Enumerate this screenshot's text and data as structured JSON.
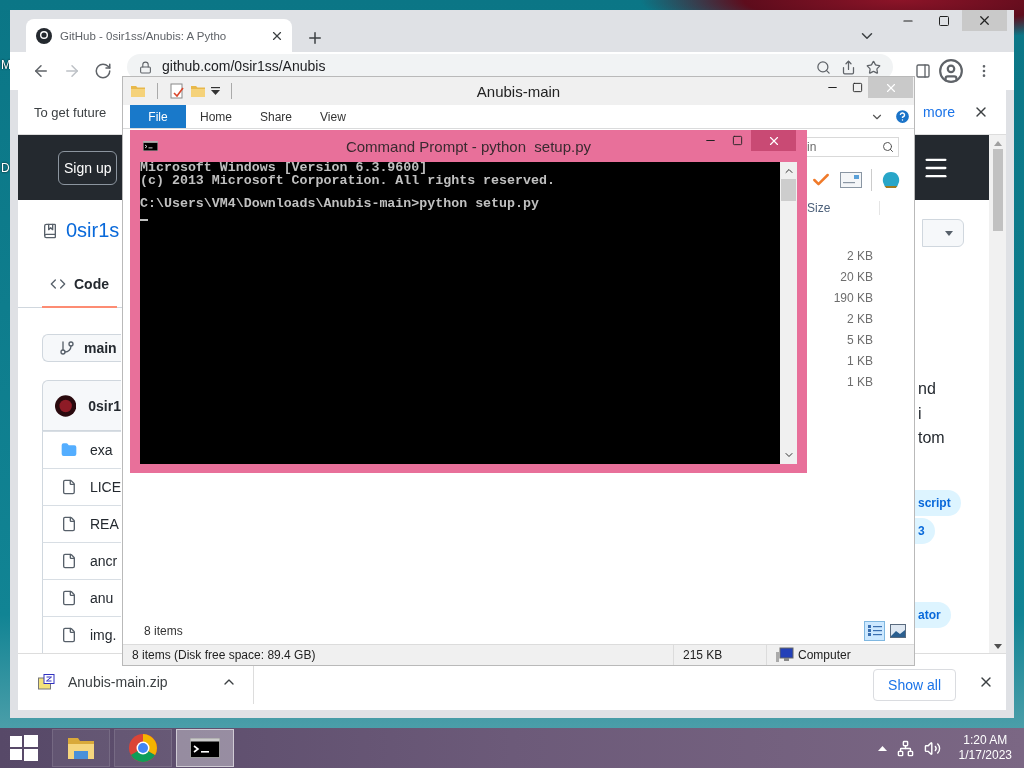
{
  "desktop": {
    "icon_labels": [
      "M",
      "D"
    ]
  },
  "browser": {
    "tab": {
      "title": "GitHub - 0sir1ss/Anubis: A Pytho"
    },
    "address": "github.com/0sir1ss/Anubis",
    "infobar": {
      "text": "To get future",
      "link": "more"
    },
    "page": {
      "signup": "Sign up",
      "repo": "0sir1s",
      "code_tab": {
        "label": "Code",
        "selected": true
      },
      "branch": "main",
      "commit_author": "0sir1",
      "files": [
        {
          "kind": "folder",
          "name": "exa"
        },
        {
          "kind": "file",
          "name": "LICE"
        },
        {
          "kind": "file",
          "name": "REA"
        },
        {
          "kind": "file",
          "name": "ancr"
        },
        {
          "kind": "file",
          "name": "anu"
        },
        {
          "kind": "file",
          "name": "img."
        }
      ],
      "about_fragments": [
        "nd",
        "i",
        "tom"
      ],
      "topics": [
        "script",
        "3",
        "ator"
      ]
    },
    "download": {
      "file": "Anubis-main.zip",
      "show_all": "Show all"
    }
  },
  "explorer": {
    "title": "Anubis-main",
    "ribbon_tabs": [
      {
        "label": "File",
        "kind": "menu"
      },
      {
        "label": "Home",
        "kind": "tab"
      },
      {
        "label": "Share",
        "kind": "tab"
      },
      {
        "label": "View",
        "kind": "tab"
      }
    ],
    "search": {
      "placeholder": "in"
    },
    "size_header": "Size",
    "sizes": [
      "2 KB",
      "20 KB",
      "190 KB",
      "2 KB",
      "5 KB",
      "1 KB",
      "1 KB"
    ],
    "item_count": "8 items",
    "views": [
      {
        "kind": "details",
        "selected": true
      },
      {
        "kind": "thumbnails",
        "selected": false
      }
    ],
    "status": {
      "summary": "8 items (Disk free space: 89.4 GB)",
      "size": "215 KB",
      "location": "Computer"
    }
  },
  "console": {
    "title": "Command Prompt - python  setup.py",
    "blocks": [
      [
        "Microsoft Windows [Version 6.3.9600]",
        "(c) 2013 Microsoft Corporation. All rights reserved."
      ],
      [
        "C:\\Users\\VM4\\Downloads\\Anubis-main>python setup.py"
      ]
    ]
  },
  "taskbar": {
    "apps": [
      {
        "kind": "explorer",
        "selected": false
      },
      {
        "kind": "chrome",
        "selected": false
      },
      {
        "kind": "cmd",
        "selected": true
      }
    ],
    "time": "1:20 AM",
    "date": "1/17/2023"
  }
}
